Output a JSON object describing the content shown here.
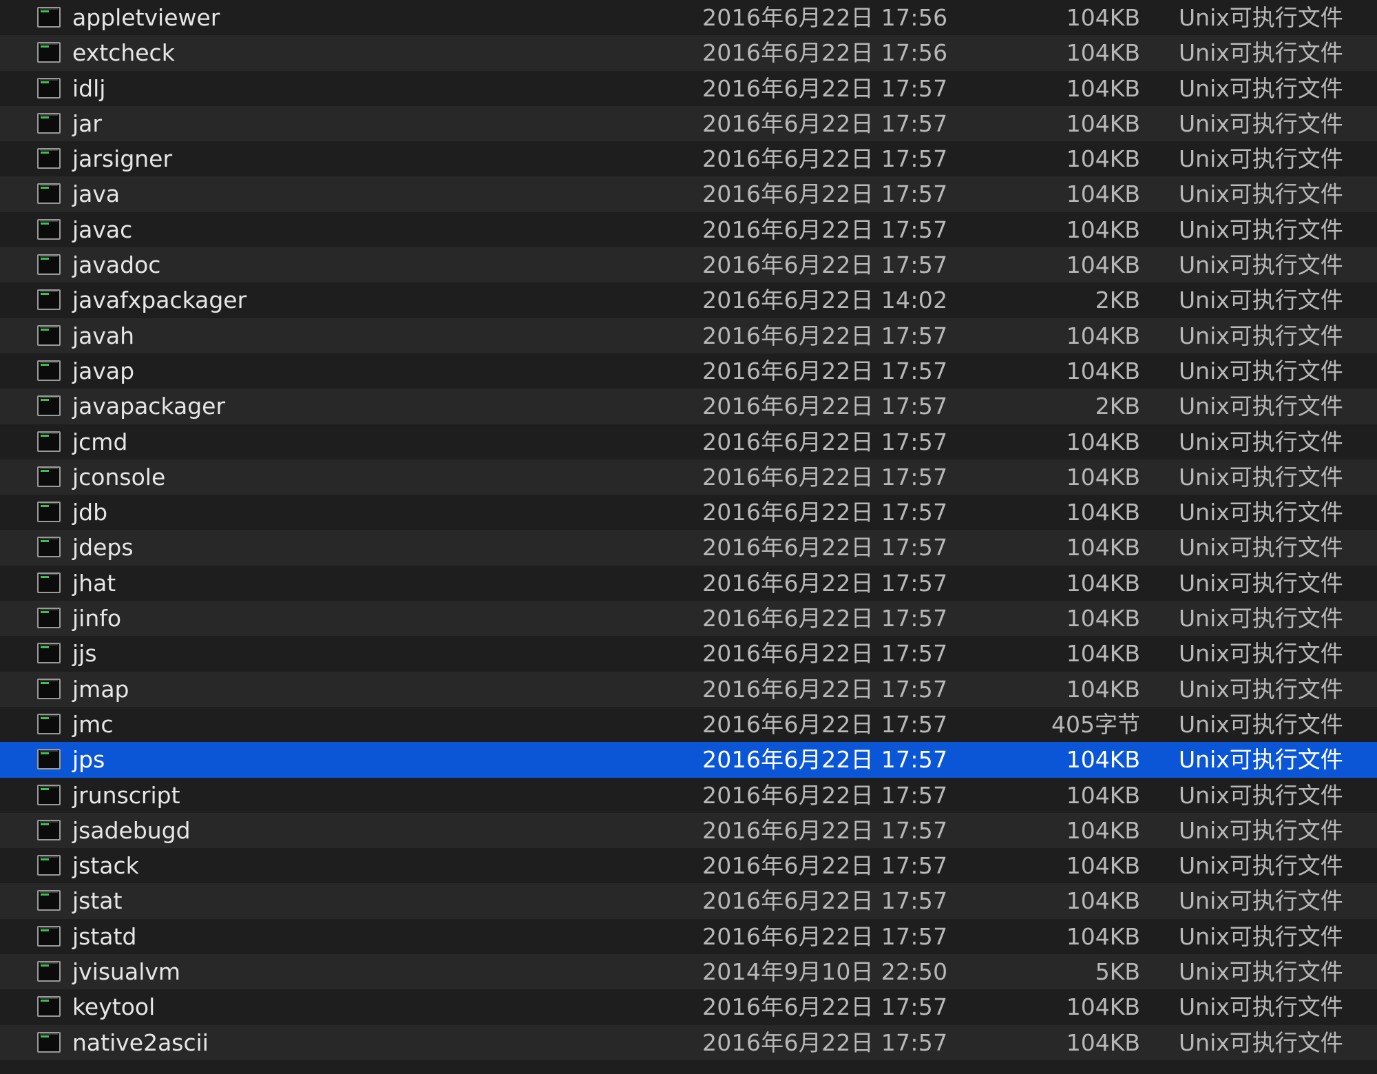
{
  "window": {
    "colors": {
      "background_even": "#1e1e1e",
      "background_odd": "#282828",
      "selection": "#0a56d6",
      "icon_accent": "#3fbf4f"
    }
  },
  "file_list": {
    "icon_semantic": "unix-executable-icon",
    "rows": [
      {
        "name": "appletviewer",
        "date": "2016年6月22日 17:56",
        "size": "104KB",
        "kind": "Unix可执行文件",
        "selected": false
      },
      {
        "name": "extcheck",
        "date": "2016年6月22日 17:56",
        "size": "104KB",
        "kind": "Unix可执行文件",
        "selected": false
      },
      {
        "name": "idlj",
        "date": "2016年6月22日 17:57",
        "size": "104KB",
        "kind": "Unix可执行文件",
        "selected": false
      },
      {
        "name": "jar",
        "date": "2016年6月22日 17:57",
        "size": "104KB",
        "kind": "Unix可执行文件",
        "selected": false
      },
      {
        "name": "jarsigner",
        "date": "2016年6月22日 17:57",
        "size": "104KB",
        "kind": "Unix可执行文件",
        "selected": false
      },
      {
        "name": "java",
        "date": "2016年6月22日 17:57",
        "size": "104KB",
        "kind": "Unix可执行文件",
        "selected": false
      },
      {
        "name": "javac",
        "date": "2016年6月22日 17:57",
        "size": "104KB",
        "kind": "Unix可执行文件",
        "selected": false
      },
      {
        "name": "javadoc",
        "date": "2016年6月22日 17:57",
        "size": "104KB",
        "kind": "Unix可执行文件",
        "selected": false
      },
      {
        "name": "javafxpackager",
        "date": "2016年6月22日 14:02",
        "size": "2KB",
        "kind": "Unix可执行文件",
        "selected": false
      },
      {
        "name": "javah",
        "date": "2016年6月22日 17:57",
        "size": "104KB",
        "kind": "Unix可执行文件",
        "selected": false
      },
      {
        "name": "javap",
        "date": "2016年6月22日 17:57",
        "size": "104KB",
        "kind": "Unix可执行文件",
        "selected": false
      },
      {
        "name": "javapackager",
        "date": "2016年6月22日 17:57",
        "size": "2KB",
        "kind": "Unix可执行文件",
        "selected": false
      },
      {
        "name": "jcmd",
        "date": "2016年6月22日 17:57",
        "size": "104KB",
        "kind": "Unix可执行文件",
        "selected": false
      },
      {
        "name": "jconsole",
        "date": "2016年6月22日 17:57",
        "size": "104KB",
        "kind": "Unix可执行文件",
        "selected": false
      },
      {
        "name": "jdb",
        "date": "2016年6月22日 17:57",
        "size": "104KB",
        "kind": "Unix可执行文件",
        "selected": false
      },
      {
        "name": "jdeps",
        "date": "2016年6月22日 17:57",
        "size": "104KB",
        "kind": "Unix可执行文件",
        "selected": false
      },
      {
        "name": "jhat",
        "date": "2016年6月22日 17:57",
        "size": "104KB",
        "kind": "Unix可执行文件",
        "selected": false
      },
      {
        "name": "jinfo",
        "date": "2016年6月22日 17:57",
        "size": "104KB",
        "kind": "Unix可执行文件",
        "selected": false
      },
      {
        "name": "jjs",
        "date": "2016年6月22日 17:57",
        "size": "104KB",
        "kind": "Unix可执行文件",
        "selected": false
      },
      {
        "name": "jmap",
        "date": "2016年6月22日 17:57",
        "size": "104KB",
        "kind": "Unix可执行文件",
        "selected": false
      },
      {
        "name": "jmc",
        "date": "2016年6月22日 17:57",
        "size": "405字节",
        "kind": "Unix可执行文件",
        "selected": false
      },
      {
        "name": "jps",
        "date": "2016年6月22日 17:57",
        "size": "104KB",
        "kind": "Unix可执行文件",
        "selected": true
      },
      {
        "name": "jrunscript",
        "date": "2016年6月22日 17:57",
        "size": "104KB",
        "kind": "Unix可执行文件",
        "selected": false
      },
      {
        "name": "jsadebugd",
        "date": "2016年6月22日 17:57",
        "size": "104KB",
        "kind": "Unix可执行文件",
        "selected": false
      },
      {
        "name": "jstack",
        "date": "2016年6月22日 17:57",
        "size": "104KB",
        "kind": "Unix可执行文件",
        "selected": false
      },
      {
        "name": "jstat",
        "date": "2016年6月22日 17:57",
        "size": "104KB",
        "kind": "Unix可执行文件",
        "selected": false
      },
      {
        "name": "jstatd",
        "date": "2016年6月22日 17:57",
        "size": "104KB",
        "kind": "Unix可执行文件",
        "selected": false
      },
      {
        "name": "jvisualvm",
        "date": "2014年9月10日 22:50",
        "size": "5KB",
        "kind": "Unix可执行文件",
        "selected": false
      },
      {
        "name": "keytool",
        "date": "2016年6月22日 17:57",
        "size": "104KB",
        "kind": "Unix可执行文件",
        "selected": false
      },
      {
        "name": "native2ascii",
        "date": "2016年6月22日 17:57",
        "size": "104KB",
        "kind": "Unix可执行文件",
        "selected": false
      }
    ]
  }
}
